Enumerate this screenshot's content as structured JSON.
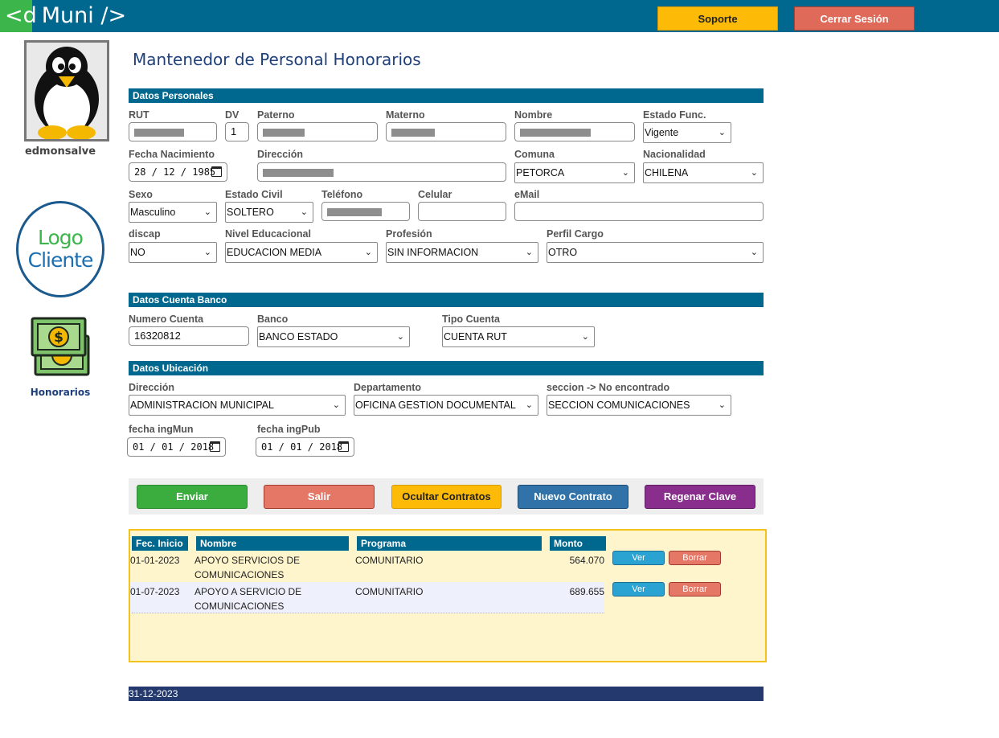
{
  "header": {
    "logo_prefix": "<d",
    "logo_suffix": "Muni />",
    "soporte_label": "Soporte",
    "cerrar_label": "Cerrar Sesión"
  },
  "sidebar": {
    "username": "edmonsalve",
    "client_logo_line1": "Logo",
    "client_logo_line2": "Cliente",
    "honorarios_label": "Honorarios"
  },
  "page": {
    "title": "Mantenedor de Personal Honorarios"
  },
  "datos_personales": {
    "section_title": "Datos Personales",
    "rut": {
      "label": "RUT",
      "value": ""
    },
    "dv": {
      "label": "DV",
      "value": "1"
    },
    "paterno": {
      "label": "Paterno",
      "value": ""
    },
    "materno": {
      "label": "Materno",
      "value": ""
    },
    "nombre": {
      "label": "Nombre",
      "value": ""
    },
    "estado_func": {
      "label": "Estado Func.",
      "value": "Vigente"
    },
    "fecha_nacimiento": {
      "label": "Fecha Nacimiento",
      "value": "28 / 12 / 1985"
    },
    "direccion": {
      "label": "Dirección",
      "value": ""
    },
    "comuna": {
      "label": "Comuna",
      "value": "PETORCA"
    },
    "nacionalidad": {
      "label": "Nacionalidad",
      "value": "CHILENA"
    },
    "sexo": {
      "label": "Sexo",
      "value": "Masculino"
    },
    "estado_civil": {
      "label": "Estado Civil",
      "value": "SOLTERO"
    },
    "telefono": {
      "label": "Teléfono",
      "value": ""
    },
    "celular": {
      "label": "Celular",
      "value": ""
    },
    "email": {
      "label": "eMail",
      "value": ""
    },
    "discap": {
      "label": "discap",
      "value": "NO"
    },
    "nivel_educacional": {
      "label": "Nivel Educacional",
      "value": "EDUCACION MEDIA"
    },
    "profesion": {
      "label": "Profesión",
      "value": "SIN INFORMACION"
    },
    "perfil_cargo": {
      "label": "Perfil Cargo",
      "value": "OTRO"
    }
  },
  "datos_cuenta_banco": {
    "section_title": "Datos Cuenta Banco",
    "numero_cuenta": {
      "label": "Numero Cuenta",
      "value": "16320812"
    },
    "banco": {
      "label": "Banco",
      "value": "BANCO ESTADO"
    },
    "tipo_cuenta": {
      "label": "Tipo Cuenta",
      "value": "CUENTA RUT"
    }
  },
  "datos_ubicacion": {
    "section_title": "Datos Ubicación",
    "direccion": {
      "label": "Dirección",
      "value": "ADMINISTRACION MUNICIPAL"
    },
    "departamento": {
      "label": "Departamento",
      "value": "OFICINA GESTION DOCUMENTAL"
    },
    "seccion": {
      "label": "seccion -> No encontrado",
      "value": "SECCION COMUNICACIONES"
    },
    "fecha_ingmun": {
      "label": "fecha ingMun",
      "value": "01 / 01 / 2018"
    },
    "fecha_ingpub": {
      "label": "fecha ingPub",
      "value": "01 / 01 / 2018"
    }
  },
  "actions": {
    "enviar": "Enviar",
    "salir": "Salir",
    "ocultar": "Ocultar Contratos",
    "nuevo": "Nuevo Contrato",
    "regenerar": "Regenar Clave"
  },
  "contracts": {
    "headers": [
      "Fec. Inicio",
      "Nombre",
      "Programa",
      "Monto"
    ],
    "rows": [
      {
        "fecha": "01-01-2023",
        "nombre_l1": "APOYO SERVICIOS DE",
        "nombre_l2": "COMUNICACIONES",
        "programa": "COMUNITARIO",
        "monto": "564.070",
        "ver": "Ver",
        "borrar": "Borrar"
      },
      {
        "fecha": "01-07-2023",
        "nombre_l1": "APOYO A SERVICIO DE",
        "nombre_l2": "COMUNICACIONES",
        "programa": "COMUNITARIO",
        "monto": "689.655",
        "ver": "Ver",
        "borrar": "Borrar"
      }
    ]
  },
  "footer": {
    "date": "31-12-2023"
  }
}
